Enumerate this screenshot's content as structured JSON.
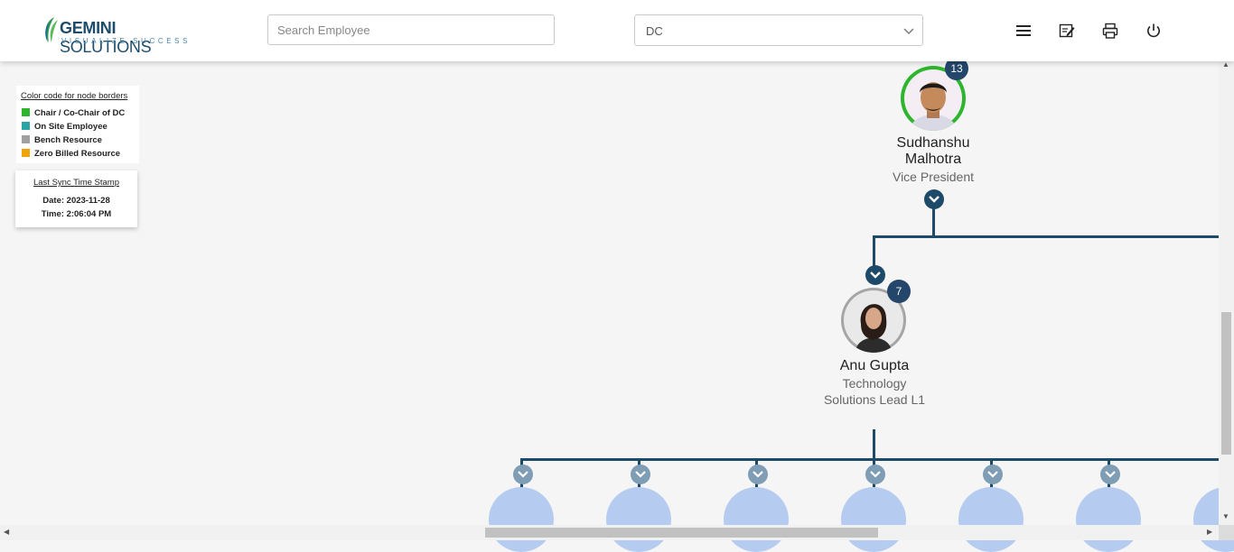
{
  "header": {
    "brand_bold": "GEMINI",
    "brand_light": " SOLUTIONS",
    "tagline": "VISUALIZE SUCCESS",
    "search_placeholder": "Search Employee",
    "dropdown_value": "DC"
  },
  "legend": {
    "title": "Color code for node borders",
    "items": [
      {
        "label": "Chair / Co-Chair of DC",
        "color": "#2db52d"
      },
      {
        "label": "On Site Employee",
        "color": "#2aa5a5"
      },
      {
        "label": "Bench Resource",
        "color": "#a0a0a0"
      },
      {
        "label": "Zero Billed Resource",
        "color": "#f0a30a"
      }
    ]
  },
  "sync": {
    "title": "Last Sync Time Stamp",
    "date": "Date: 2023-11-28",
    "time": "Time: 2:06:04 PM"
  },
  "nodes": {
    "top": {
      "name_line1": "Sudhanshu",
      "name_line2": "Malhotra",
      "title": "Vice President",
      "count": "13",
      "border_color": "#2db52d"
    },
    "child": {
      "name": "Anu Gupta",
      "title_line1": "Technology",
      "title_line2": "Solutions Lead L1",
      "count": "7"
    }
  },
  "icons": [
    "menu-icon",
    "edit-note-icon",
    "print-icon",
    "power-icon",
    "chevron-down-icon"
  ]
}
